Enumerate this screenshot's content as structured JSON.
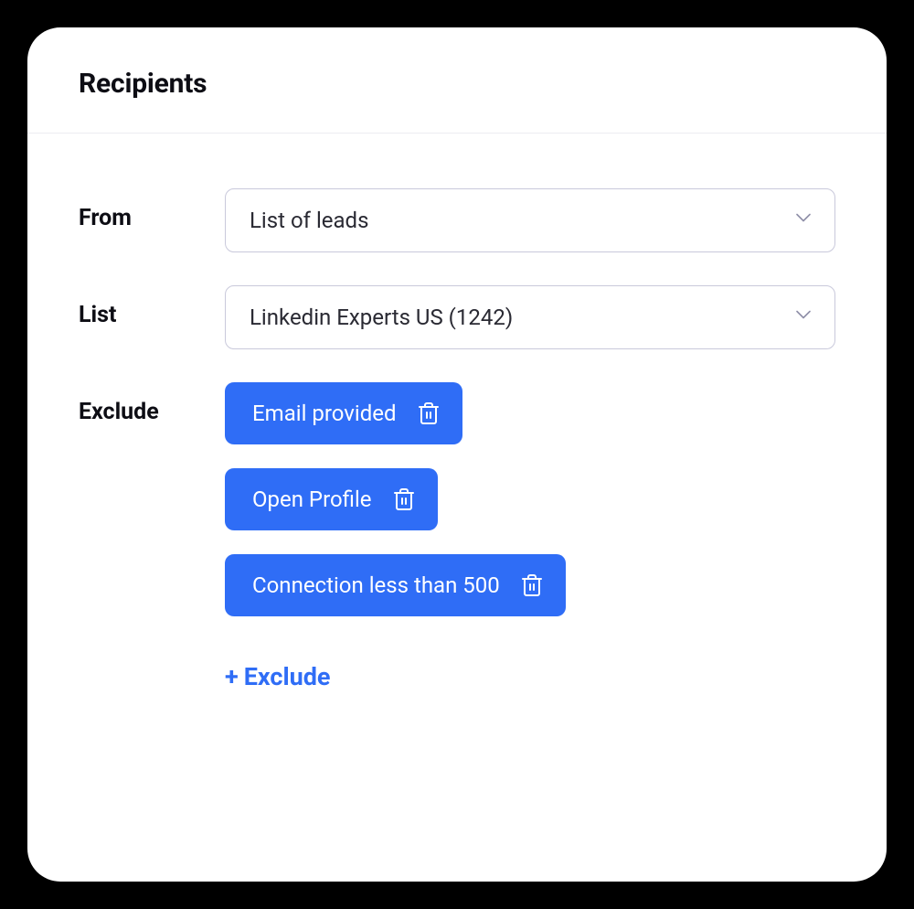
{
  "header": {
    "title": "Recipients"
  },
  "form": {
    "from": {
      "label": "From",
      "value": "List of leads"
    },
    "list": {
      "label": "List",
      "value": "Linkedin Experts US (1242)"
    },
    "exclude": {
      "label": "Exclude",
      "items": [
        {
          "label": "Email provided"
        },
        {
          "label": "Open Profile"
        },
        {
          "label": "Connection less than 500"
        }
      ],
      "add_label": "Exclude"
    }
  },
  "colors": {
    "accent": "#2f6df6"
  }
}
